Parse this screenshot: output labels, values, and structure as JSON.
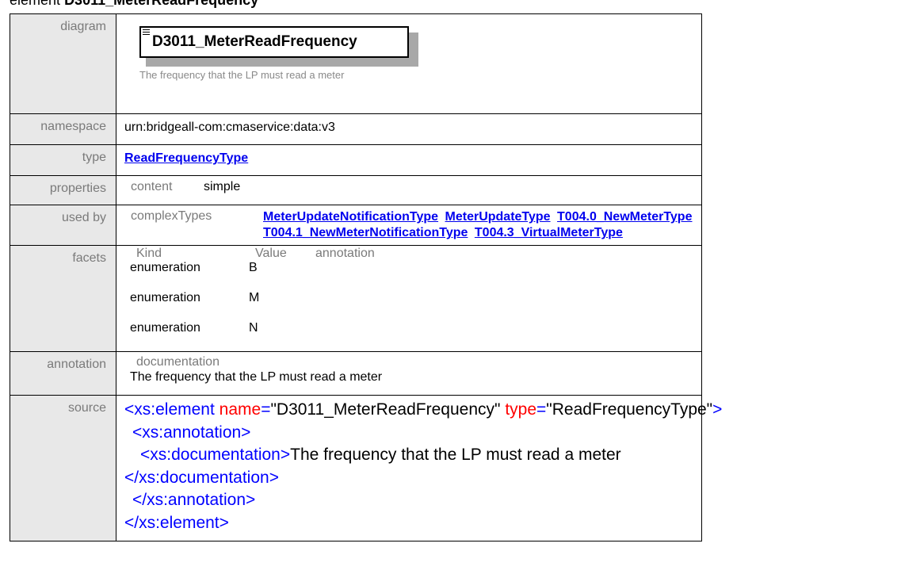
{
  "heading": {
    "prefix": "element",
    "name": "D3011_MeterReadFrequency"
  },
  "labels": {
    "diagram": "diagram",
    "namespace": "namespace",
    "type": "type",
    "properties": "properties",
    "used_by": "used by",
    "facets": "facets",
    "annotation": "annotation",
    "source": "source"
  },
  "diagram": {
    "element_name": "D3011_MeterReadFrequency",
    "documentation": "The frequency that the LP must read a meter"
  },
  "namespace": "urn:bridgeall-com:cmaservice:data:v3",
  "type": "ReadFrequencyType",
  "properties": {
    "key": "content",
    "value": "simple"
  },
  "used_by": {
    "key": "complexTypes",
    "items": [
      "MeterUpdateNotificationType",
      "MeterUpdateType",
      "T004.0_NewMeterType",
      "T004.1_NewMeterNotificationType",
      "T004.3_VirtualMeterType"
    ]
  },
  "facets": {
    "headers": [
      "Kind",
      "Value",
      "annotation"
    ],
    "rows": [
      {
        "kind": "enumeration",
        "value": "B"
      },
      {
        "kind": "enumeration",
        "value": "M"
      },
      {
        "kind": "enumeration",
        "value": "N"
      }
    ]
  },
  "annotation": {
    "key": "documentation",
    "text": "The frequency that the LP must read a meter"
  },
  "source": {
    "l1_open": "<xs:element",
    "l1_attr1": "name",
    "l1_val1": "\"D3011_MeterReadFrequency\"",
    "l1_attr2": "type",
    "l1_val2": "\"ReadFrequencyType\"",
    "l1_close": ">",
    "l2": "<xs:annotation>",
    "l3_open": "<xs:documentation>",
    "l3_text": "The frequency that the LP must read a meter",
    "l4": "</xs:documentation>",
    "l5": "</xs:annotation>",
    "l6": "</xs:element>"
  }
}
